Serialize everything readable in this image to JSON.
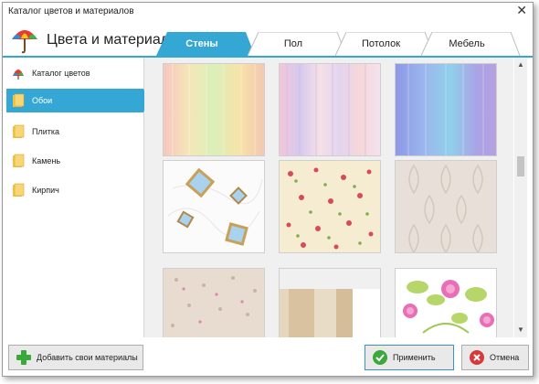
{
  "window": {
    "title": "Каталог цветов и материалов",
    "close_glyph": "✕"
  },
  "header": {
    "title": "Цвета и материалы",
    "icon": "umbrella-icon"
  },
  "tabs": [
    {
      "label": "Стены",
      "active": true
    },
    {
      "label": "Пол",
      "active": false
    },
    {
      "label": "Потолок",
      "active": false
    },
    {
      "label": "Мебель",
      "active": false
    }
  ],
  "sidebar": {
    "items": [
      {
        "label": "Каталог цветов",
        "icon": "palette-icon",
        "active": false
      },
      {
        "label": "Обои",
        "icon": "folder-icon",
        "active": true
      },
      {
        "label": "Плитка",
        "icon": "folder-icon",
        "active": false
      },
      {
        "label": "Камень",
        "icon": "folder-icon",
        "active": false
      },
      {
        "label": "Кирпич",
        "icon": "folder-icon",
        "active": false
      }
    ]
  },
  "textures": [
    {
      "kind": "pastel-stripes-warm"
    },
    {
      "kind": "pastel-stripes-pink"
    },
    {
      "kind": "blue-purple-stripes"
    },
    {
      "kind": "diamond-frames"
    },
    {
      "kind": "red-floral-cream"
    },
    {
      "kind": "beige-damask"
    },
    {
      "kind": "small-floral-beige"
    },
    {
      "kind": "beige-wide-stripes"
    },
    {
      "kind": "green-pink-flowers"
    }
  ],
  "scrollbar": {
    "up": "▲",
    "down": "▼"
  },
  "footer": {
    "add_label": "Добавить свои материалы",
    "apply_label": "Применить",
    "cancel_label": "Отмена"
  },
  "colors": {
    "accent": "#35a7d4",
    "apply_green": "#3aa83a",
    "cancel_red": "#d63a3a"
  }
}
